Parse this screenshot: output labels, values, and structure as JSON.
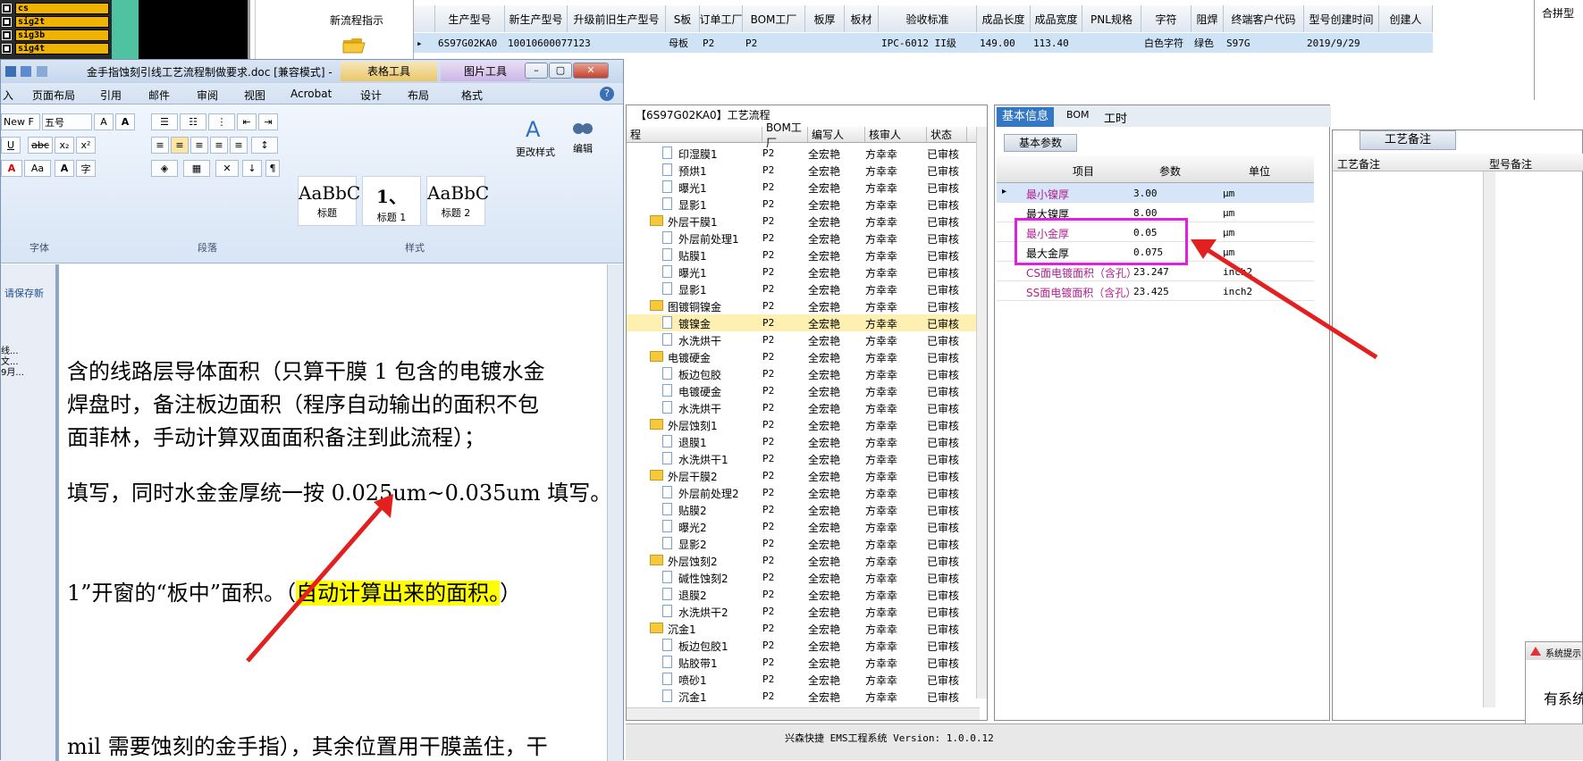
{
  "signals": [
    "cs",
    "sig2t",
    "sig3b",
    "sig4t"
  ],
  "flow_indicator": {
    "label": "新流程指示"
  },
  "top_grid": {
    "headers": [
      "生产型号",
      "新生产型号",
      "升级前旧生产型号",
      "S板",
      "订单工厂",
      "BOM工厂",
      "板厚",
      "板材",
      "验收标准",
      "成品长度",
      "成品宽度",
      "PNL规格",
      "字符",
      "阻焊",
      "终端客户代码",
      "型号创建时间",
      "创建人"
    ],
    "row": [
      "6S97G02KA0",
      "10010600077123",
      "",
      "母板",
      "P2",
      "P2",
      "",
      "",
      "IPC-6012 II级",
      "149.00",
      "113.40",
      "",
      "白色字符",
      "绿色",
      "S97G",
      "2019/9/29",
      ""
    ],
    "right_panel_label": "合拼型"
  },
  "word": {
    "title": "金手指蚀刻引线工艺流程制做要求.doc [兼容模式] -",
    "context_tabs": [
      "表格工具",
      "图片工具"
    ],
    "tabs": [
      "入",
      "页面布局",
      "引用",
      "邮件",
      "审阅",
      "视图",
      "Acrobat",
      "设计",
      "布局",
      "格式"
    ],
    "font_name": "New F",
    "font_size": "五号",
    "groups": [
      "字体",
      "段落",
      "样式"
    ],
    "styles": [
      {
        "preview": "AaBbC",
        "name": "标题"
      },
      {
        "preview": "1、",
        "name": "标题 1"
      },
      {
        "preview": "AaBbC",
        "name": "标题 2"
      }
    ],
    "change_styles": "更改样式",
    "edit": "编辑",
    "nav_text": "请保存新",
    "nav_items": [
      "线...",
      "文...",
      "9月..."
    ],
    "paragraphs": [
      "含的线路层导体面积（只算干膜 1 包含的电镀水金",
      "焊盘时，备注板边面积（程序自动输出的面积不包",
      "面菲林，手动计算双面面积备注到此流程）；",
      "填写，同时水金金厚统一按 0.025um~0.035um 填写。",
      "1”开窗的“板中”面积。（",
      "自动计算出来的面积。",
      "）",
      "mil 需要蚀刻的金手指），其余位置用干膜盖住，干"
    ]
  },
  "process": {
    "title": "【6S97G02KA0】工艺流程",
    "headers": [
      "程",
      "BOM工厂",
      "编写人",
      "核审人",
      "状态"
    ],
    "rows": [
      {
        "name": "印湿膜1",
        "type": "doc",
        "f": "P2",
        "w": "全宏艳",
        "r": "方幸幸",
        "s": "已审核"
      },
      {
        "name": "预烘1",
        "type": "doc",
        "f": "P2",
        "w": "全宏艳",
        "r": "方幸幸",
        "s": "已审核"
      },
      {
        "name": "曝光1",
        "type": "doc",
        "f": "P2",
        "w": "全宏艳",
        "r": "方幸幸",
        "s": "已审核"
      },
      {
        "name": "显影1",
        "type": "doc",
        "f": "P2",
        "w": "全宏艳",
        "r": "方幸幸",
        "s": "已审核"
      },
      {
        "name": "外层干膜1",
        "type": "folder",
        "f": "P2",
        "w": "全宏艳",
        "r": "方幸幸",
        "s": "已审核"
      },
      {
        "name": "外层前处理1",
        "type": "doc",
        "f": "P2",
        "w": "全宏艳",
        "r": "方幸幸",
        "s": "已审核"
      },
      {
        "name": "贴膜1",
        "type": "doc",
        "f": "P2",
        "w": "全宏艳",
        "r": "方幸幸",
        "s": "已审核"
      },
      {
        "name": "曝光1",
        "type": "doc",
        "f": "P2",
        "w": "全宏艳",
        "r": "方幸幸",
        "s": "已审核"
      },
      {
        "name": "显影1",
        "type": "doc",
        "f": "P2",
        "w": "全宏艳",
        "r": "方幸幸",
        "s": "已审核"
      },
      {
        "name": "图镀铜镍金",
        "type": "folder",
        "f": "P2",
        "w": "全宏艳",
        "r": "方幸幸",
        "s": "已审核"
      },
      {
        "name": "镀镍金",
        "type": "doc",
        "f": "P2",
        "w": "全宏艳",
        "r": "方幸幸",
        "s": "已审核",
        "selected": true
      },
      {
        "name": "水洗烘干",
        "type": "doc",
        "f": "P2",
        "w": "全宏艳",
        "r": "方幸幸",
        "s": "已审核"
      },
      {
        "name": "电镀硬金",
        "type": "folder",
        "f": "P2",
        "w": "全宏艳",
        "r": "方幸幸",
        "s": "已审核"
      },
      {
        "name": "板边包胶",
        "type": "doc",
        "f": "P2",
        "w": "全宏艳",
        "r": "方幸幸",
        "s": "已审核"
      },
      {
        "name": "电镀硬金",
        "type": "doc",
        "f": "P2",
        "w": "全宏艳",
        "r": "方幸幸",
        "s": "已审核"
      },
      {
        "name": "水洗烘干",
        "type": "doc",
        "f": "P2",
        "w": "全宏艳",
        "r": "方幸幸",
        "s": "已审核"
      },
      {
        "name": "外层蚀刻1",
        "type": "folder",
        "f": "P2",
        "w": "全宏艳",
        "r": "方幸幸",
        "s": "已审核"
      },
      {
        "name": "退膜1",
        "type": "doc",
        "f": "P2",
        "w": "全宏艳",
        "r": "方幸幸",
        "s": "已审核"
      },
      {
        "name": "水洗烘干1",
        "type": "doc",
        "f": "P2",
        "w": "全宏艳",
        "r": "方幸幸",
        "s": "已审核"
      },
      {
        "name": "外层干膜2",
        "type": "folder",
        "f": "P2",
        "w": "全宏艳",
        "r": "方幸幸",
        "s": "已审核"
      },
      {
        "name": "外层前处理2",
        "type": "doc",
        "f": "P2",
        "w": "全宏艳",
        "r": "方幸幸",
        "s": "已审核"
      },
      {
        "name": "贴膜2",
        "type": "doc",
        "f": "P2",
        "w": "全宏艳",
        "r": "方幸幸",
        "s": "已审核"
      },
      {
        "name": "曝光2",
        "type": "doc",
        "f": "P2",
        "w": "全宏艳",
        "r": "方幸幸",
        "s": "已审核"
      },
      {
        "name": "显影2",
        "type": "doc",
        "f": "P2",
        "w": "全宏艳",
        "r": "方幸幸",
        "s": "已审核"
      },
      {
        "name": "外层蚀刻2",
        "type": "folder",
        "f": "P2",
        "w": "全宏艳",
        "r": "方幸幸",
        "s": "已审核"
      },
      {
        "name": "碱性蚀刻2",
        "type": "doc",
        "f": "P2",
        "w": "全宏艳",
        "r": "方幸幸",
        "s": "已审核"
      },
      {
        "name": "退膜2",
        "type": "doc",
        "f": "P2",
        "w": "全宏艳",
        "r": "方幸幸",
        "s": "已审核"
      },
      {
        "name": "水洗烘干2",
        "type": "doc",
        "f": "P2",
        "w": "全宏艳",
        "r": "方幸幸",
        "s": "已审核"
      },
      {
        "name": "沉金1",
        "type": "folder",
        "f": "P2",
        "w": "全宏艳",
        "r": "方幸幸",
        "s": "已审核"
      },
      {
        "name": "板边包胶1",
        "type": "doc",
        "f": "P2",
        "w": "全宏艳",
        "r": "方幸幸",
        "s": "已审核"
      },
      {
        "name": "贴胶带1",
        "type": "doc",
        "f": "P2",
        "w": "全宏艳",
        "r": "方幸幸",
        "s": "已审核"
      },
      {
        "name": "喷砂1",
        "type": "doc",
        "f": "P2",
        "w": "全宏艳",
        "r": "方幸幸",
        "s": "已审核"
      },
      {
        "name": "沉金1",
        "type": "doc",
        "f": "P2",
        "w": "全宏艳",
        "r": "方幸幸",
        "s": "已审核"
      }
    ]
  },
  "info": {
    "tabs": [
      "基本信息",
      "BOM",
      "工时"
    ],
    "param_tab": "基本参数",
    "headers": [
      "项目",
      "参数",
      "单位"
    ],
    "rows": [
      {
        "k": "最小镍厚",
        "v": "3.00",
        "u": "μm",
        "highlight_key": true,
        "selected": true
      },
      {
        "k": "最大镍厚",
        "v": "8.00",
        "u": "μm"
      },
      {
        "k": "最小金厚",
        "v": "0.05",
        "u": "μm",
        "highlight_key": true
      },
      {
        "k": "最大金厚",
        "v": "0.075",
        "u": "μm"
      },
      {
        "k": "CS面电镀面积（含孔）",
        "v": "23.247",
        "u": "inch2",
        "highlight_key": true
      },
      {
        "k": "SS面电镀面积（含孔）",
        "v": "23.425",
        "u": "inch2",
        "highlight_key": true
      }
    ]
  },
  "remarks": {
    "tab": "工艺备注",
    "col1": "工艺备注",
    "col2": "型号备注"
  },
  "message_box": {
    "title": "系统提示",
    "text": "有系统"
  },
  "status_bar": {
    "text": "兴森快捷 EMS工程系统 Version: 1.0.0.12"
  },
  "colors": {
    "accent": "#3478c5",
    "highlight_box": "#e020e0",
    "arrow": "#e32020",
    "selected_row": "#fdf0b0",
    "key_text": "#b0208f"
  }
}
